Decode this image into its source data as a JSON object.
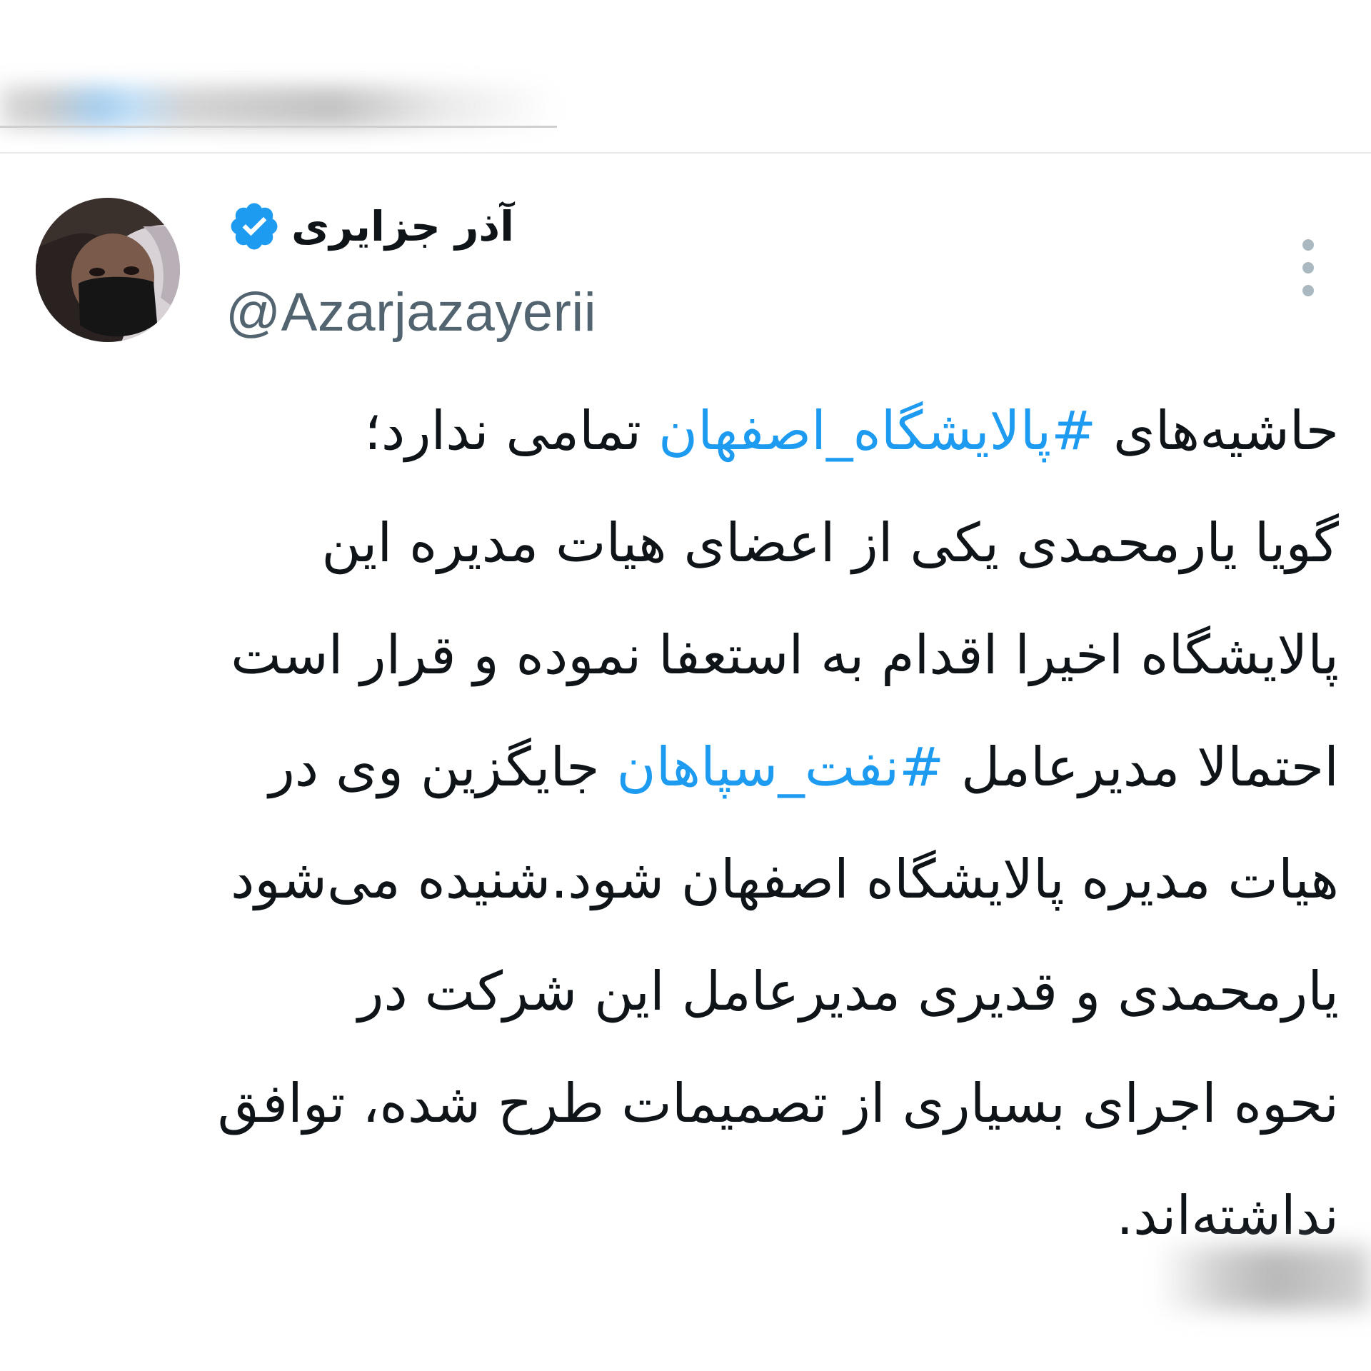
{
  "author": {
    "display_name": "آذر جزایری",
    "handle": "@Azarjazayerii",
    "verified_icon": "verified-badge-icon",
    "avatar": "profile-photo"
  },
  "menu": {
    "icon": "more-vertical-icon"
  },
  "tweet": {
    "line1": {
      "pre": "حاشیه‌های ",
      "hashtag": "#پالایشگاه_اصفهان",
      "post": " تمامی ندارد؛"
    },
    "line2": "گویا یارمحمدی یکی از اعضای هیات مدیره این",
    "line3": "پالایشگاه اخیرا اقدام به استعفا نموده و قرار است",
    "line4": {
      "pre": "احتمالا مدیرعامل ",
      "hashtag": "#نفت_سپاهان",
      "post": " جایگزین وی در"
    },
    "line5": "هیات مدیره پالایشگاه اصفهان شود.شنیده می‌شود",
    "line6": "یارمحمدی و قدیری مدیرعامل این شرکت در",
    "line7": "نحوه اجرای بسیاری از تصمیمات طرح شده، توافق",
    "line8": "نداشته‌اند."
  },
  "colors": {
    "text": "#0f1419",
    "handle": "#536471",
    "hashtag": "#1d9bf0",
    "verified": "#1d9bf0",
    "divider": "#e8e8e8"
  }
}
